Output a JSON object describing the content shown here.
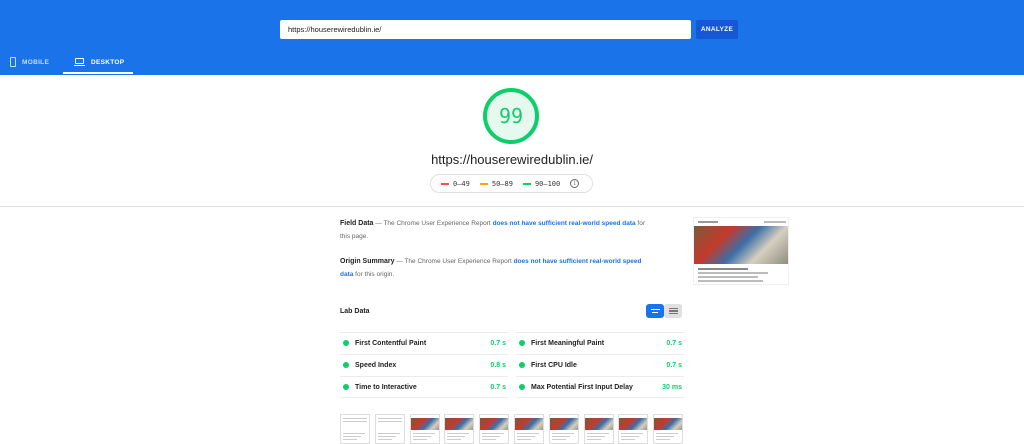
{
  "header": {
    "url_value": "https://houserewiredublin.ie/",
    "analyze_label": "ANALYZE",
    "accent_color": "#1a73e8"
  },
  "tabs": [
    {
      "label": "MOBILE",
      "icon": "mobile-icon",
      "active": false
    },
    {
      "label": "DESKTOP",
      "icon": "desktop-icon",
      "active": true
    }
  ],
  "score": {
    "value": "99",
    "url": "https://houserewiredublin.ie/",
    "color": "#0cce6b"
  },
  "legend": [
    {
      "label": "0–49",
      "color": "#ff4e42"
    },
    {
      "label": "50–89",
      "color": "#ffa400"
    },
    {
      "label": "90–100",
      "color": "#0cce6b"
    }
  ],
  "field_data": {
    "title": "Field Data",
    "text_before": " — The Chrome User Experience Report ",
    "link": "does not have sufficient real-world speed data",
    "text_after": " for this page."
  },
  "origin_summary": {
    "title": "Origin Summary",
    "text_before": " — The Chrome User Experience Report ",
    "link": "does not have sufficient real-world speed data",
    "text_after": " for this origin."
  },
  "lab_data": {
    "title": "Lab Data",
    "metrics": [
      {
        "label": "First Contentful Paint",
        "value": "0.7 s"
      },
      {
        "label": "First Meaningful Paint",
        "value": "0.7 s"
      },
      {
        "label": "Speed Index",
        "value": "0.8 s"
      },
      {
        "label": "First CPU Idle",
        "value": "0.7 s"
      },
      {
        "label": "Time to Interactive",
        "value": "0.7 s"
      },
      {
        "label": "Max Potential First Input Delay",
        "value": "30 ms"
      }
    ]
  }
}
